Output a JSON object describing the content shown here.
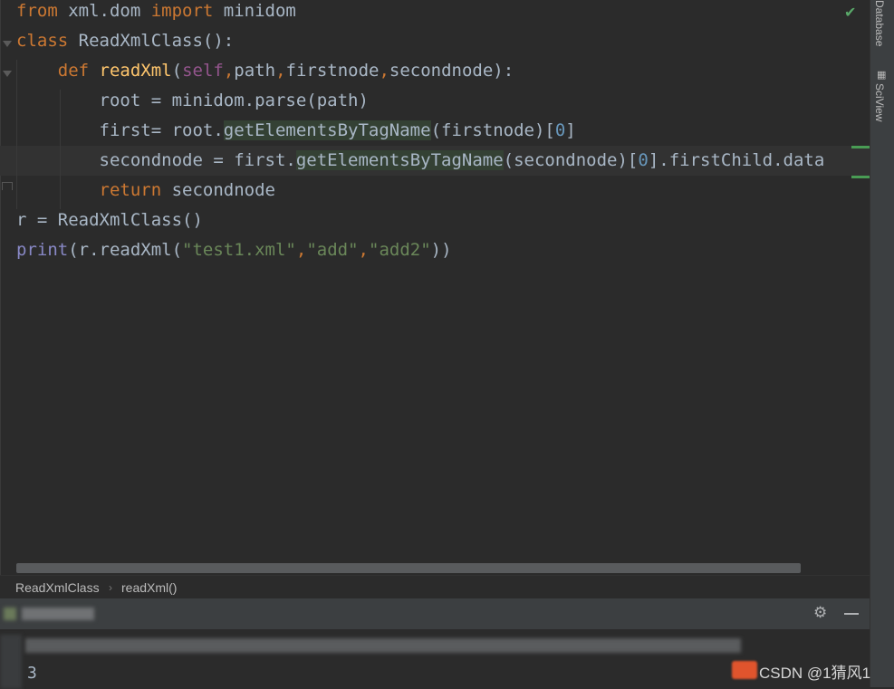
{
  "editor": {
    "lines": [
      {
        "tokens": [
          {
            "t": "from",
            "c": "kw"
          },
          {
            "t": " xml.dom ",
            "c": ""
          },
          {
            "t": "import",
            "c": "kw"
          },
          {
            "t": " minidom",
            "c": ""
          }
        ]
      },
      {
        "tokens": [
          {
            "t": "class",
            "c": "kw"
          },
          {
            "t": " ReadXmlClass():",
            "c": ""
          }
        ]
      },
      {
        "tokens": [
          {
            "t": "    ",
            "c": ""
          },
          {
            "t": "def",
            "c": "kw"
          },
          {
            "t": " ",
            "c": ""
          },
          {
            "t": "readXml",
            "c": "fn"
          },
          {
            "t": "(",
            "c": ""
          },
          {
            "t": "self",
            "c": "self"
          },
          {
            "t": ",",
            "c": "kw"
          },
          {
            "t": "path",
            "c": ""
          },
          {
            "t": ",",
            "c": "kw"
          },
          {
            "t": "firstnode",
            "c": ""
          },
          {
            "t": ",",
            "c": "kw"
          },
          {
            "t": "secondnode):",
            "c": ""
          }
        ]
      },
      {
        "tokens": [
          {
            "t": "        root = minidom.parse(path)",
            "c": ""
          }
        ]
      },
      {
        "tokens": [
          {
            "t": "        first= root.",
            "c": ""
          },
          {
            "t": "getElementsByTagName",
            "c": "hl"
          },
          {
            "t": "(firstnode)[",
            "c": ""
          },
          {
            "t": "0",
            "c": "num"
          },
          {
            "t": "]",
            "c": ""
          }
        ]
      },
      {
        "tokens": [
          {
            "t": "        secondnode = first.",
            "c": ""
          },
          {
            "t": "getElementsByTagName",
            "c": "hl"
          },
          {
            "t": "(secondnode)[",
            "c": ""
          },
          {
            "t": "0",
            "c": "num"
          },
          {
            "t": "].firstChild.data",
            "c": ""
          }
        ]
      },
      {
        "tokens": [
          {
            "t": "        ",
            "c": ""
          },
          {
            "t": "return",
            "c": "kw"
          },
          {
            "t": " secondnode",
            "c": ""
          }
        ]
      },
      {
        "tokens": [
          {
            "t": "r = ReadXmlClass()",
            "c": ""
          }
        ]
      },
      {
        "tokens": [
          {
            "t": "print",
            "c": "builtin"
          },
          {
            "t": "(r.readXml(",
            "c": ""
          },
          {
            "t": "\"test1.xml\"",
            "c": "str"
          },
          {
            "t": ",",
            "c": "kw"
          },
          {
            "t": "\"add\"",
            "c": "str"
          },
          {
            "t": ",",
            "c": "kw"
          },
          {
            "t": "\"add2\"",
            "c": "str"
          },
          {
            "t": "))",
            "c": ""
          }
        ]
      }
    ],
    "current_line_index": 5,
    "status_icon": "checkmark-icon"
  },
  "right_panel": {
    "tabs": [
      {
        "label": "Database",
        "icon": "database-icon"
      },
      {
        "label": "SciView",
        "icon": "grid-icon"
      }
    ]
  },
  "breadcrumb": {
    "items": [
      "ReadXmlClass",
      "readXml()"
    ],
    "separator": "›"
  },
  "run_panel": {
    "settings_icon": "gear-icon",
    "minimize_icon": "minimize-icon",
    "output": "3"
  },
  "watermark": {
    "text": "CSDN @1猜风1"
  },
  "colors": {
    "background": "#2b2b2b",
    "keyword": "#cc7832",
    "function": "#ffc66d",
    "self": "#94558d",
    "number": "#6897bb",
    "string": "#6a8759",
    "builtin": "#8888c6",
    "text": "#a9b7c6"
  }
}
